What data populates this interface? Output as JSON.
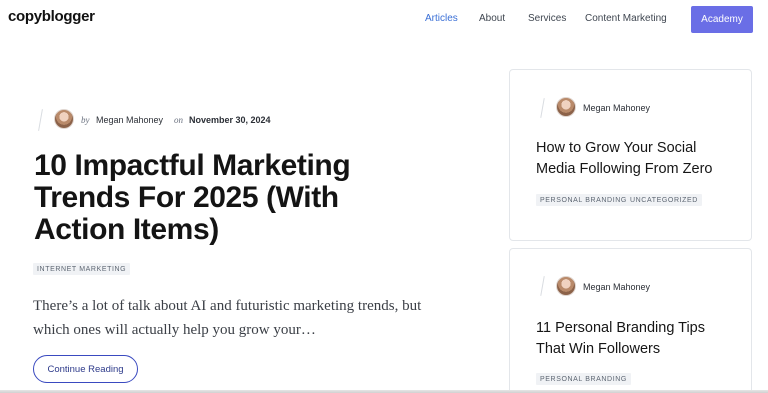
{
  "header": {
    "logo": "copyblogger",
    "nav": [
      "Articles",
      "About",
      "Services",
      "Content Marketing"
    ],
    "cta": "Academy"
  },
  "featured": {
    "by": "by",
    "author": "Megan Mahoney",
    "on": "on",
    "date": "November 30, 2024",
    "title": "10 Impactful Marketing Trends For 2025 (With Action Items)",
    "tag": "INTERNET MARKETING",
    "excerpt": "There’s a lot of talk about AI and futuristic marketing trends, but which ones will actually help you grow your…",
    "button": "Continue Reading"
  },
  "cards": [
    {
      "author": "Megan Mahoney",
      "title": "How to Grow Your Social Media Following From Zero",
      "tags": [
        "PERSONAL BRANDING",
        "UNCATEGORIZED"
      ]
    },
    {
      "author": "Megan Mahoney",
      "title": "11 Personal Branding Tips That Win Followers",
      "tags": [
        "PERSONAL BRANDING"
      ]
    }
  ]
}
